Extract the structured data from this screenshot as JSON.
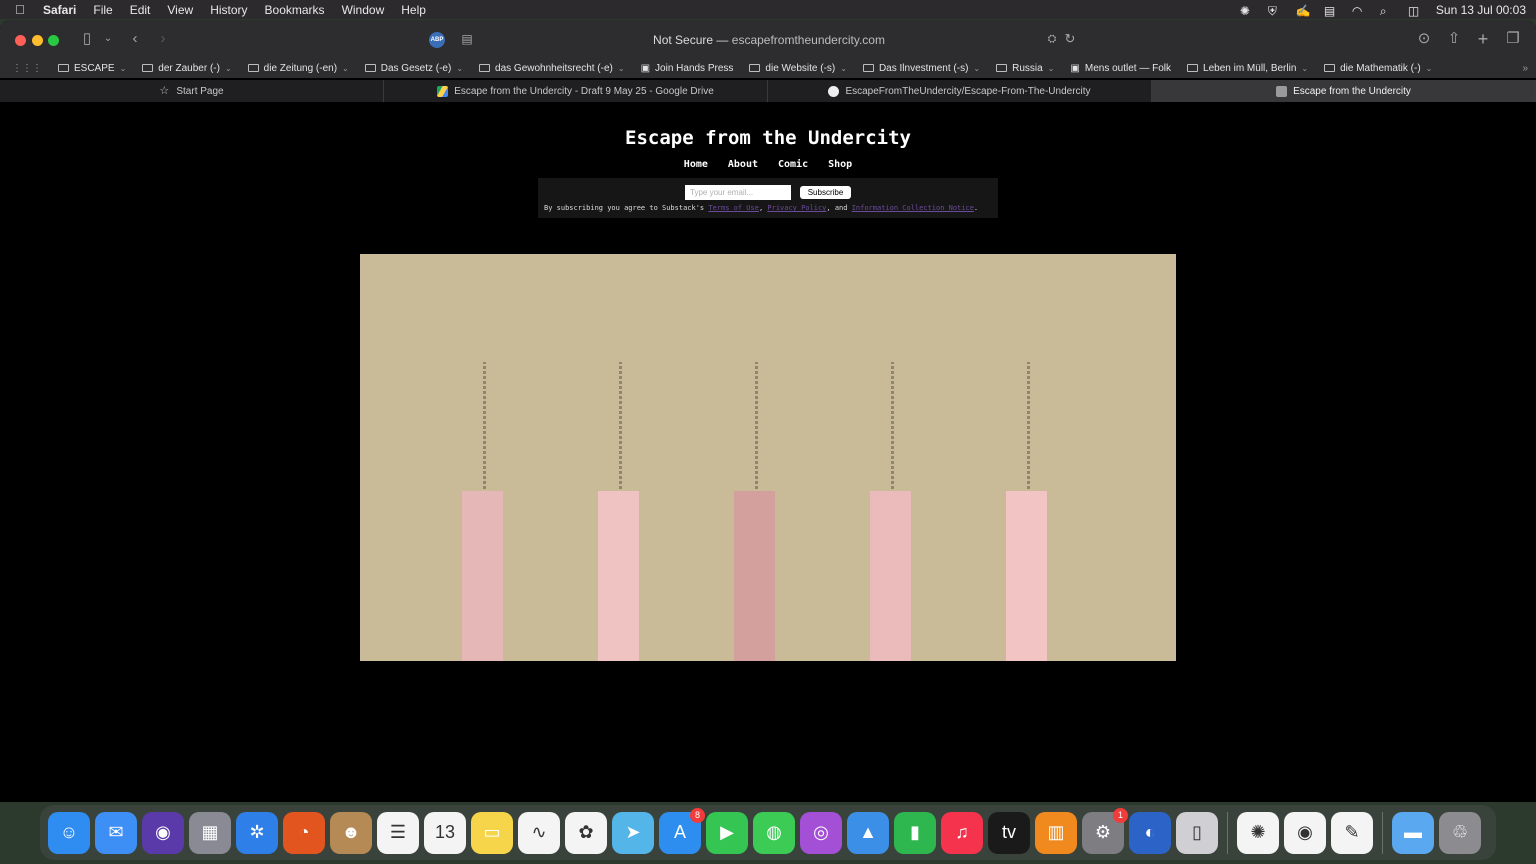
{
  "menubar": {
    "app_name": "Safari",
    "items": [
      "File",
      "Edit",
      "View",
      "History",
      "Bookmarks",
      "Window",
      "Help"
    ],
    "clock": "Sun 13 Jul  00:03"
  },
  "toolbar": {
    "address_prefix": "Not Secure —",
    "address_domain": "escapefromtheundercity.com",
    "adblock_label": "ABP"
  },
  "bookmarks": [
    {
      "label": "ESCAPE",
      "folder": true
    },
    {
      "label": "der Zauber (-)",
      "folder": true
    },
    {
      "label": "die Zeitung (-en)",
      "folder": true
    },
    {
      "label": "Das Gesetz (-e)",
      "folder": true
    },
    {
      "label": "das Gewohnheitsrecht (-e)",
      "folder": true
    },
    {
      "label": "Join Hands Press",
      "folder": false
    },
    {
      "label": "die Website (-s)",
      "folder": true
    },
    {
      "label": "Das Ilnvestment (-s)",
      "folder": true
    },
    {
      "label": "Russia",
      "folder": true
    },
    {
      "label": "Mens outlet — Folk",
      "folder": false
    },
    {
      "label": "Leben im Müll, Berlin",
      "folder": true
    },
    {
      "label": "die Mathematik (-)",
      "folder": true
    }
  ],
  "tabs": [
    {
      "label": "Start Page",
      "active": false
    },
    {
      "label": "Escape from the Undercity - Draft 9 May 25 - Google Drive",
      "active": false
    },
    {
      "label": "EscapeFromTheUndercity/Escape-From-The-Undercity",
      "active": false
    },
    {
      "label": "Escape from the Undercity",
      "active": true
    }
  ],
  "site": {
    "title": "Escape from the Undercity",
    "nav": [
      "Home",
      "About",
      "Comic",
      "Shop"
    ],
    "subscribe": {
      "placeholder": "Type your email...",
      "button": "Subscribe",
      "legal_prefix": "By subscribing you agree to Substack's",
      "terms": "Terms of Use",
      "privacy": "Privacy Policy",
      "and": ", and",
      "notice": "Information Collection Notice"
    }
  },
  "canvas": {
    "background": "#c9bb97",
    "blocks": [
      {
        "color": "#e5b7b7"
      },
      {
        "color": "#f0c3c3"
      },
      {
        "color": "#d4a09e"
      },
      {
        "color": "#ebbaba"
      },
      {
        "color": "#f2c4c4"
      }
    ]
  },
  "dock": {
    "apps": [
      {
        "name": "finder-icon",
        "color": "#2f8cf0",
        "glyph": "☺"
      },
      {
        "name": "mail-icon",
        "color": "#3d8ff5",
        "glyph": "✉"
      },
      {
        "name": "siri-icon",
        "color": "#5a3aa8",
        "glyph": "◉"
      },
      {
        "name": "launchpad-icon",
        "color": "#8a8a95",
        "glyph": "▦"
      },
      {
        "name": "safari-icon",
        "color": "#2f7fe8",
        "glyph": "✲"
      },
      {
        "name": "firefox-icon",
        "color": "#e2551f",
        "glyph": "◔"
      },
      {
        "name": "contacts-icon",
        "color": "#b58a55",
        "glyph": "☻"
      },
      {
        "name": "reminders-icon",
        "color": "#f4f4f4",
        "glyph": "☰"
      },
      {
        "name": "calendar-icon",
        "color": "#f4f4f4",
        "glyph": "13"
      },
      {
        "name": "notes-icon",
        "color": "#f6d54a",
        "glyph": "▭"
      },
      {
        "name": "freeform-icon",
        "color": "#f4f4f4",
        "glyph": "∿"
      },
      {
        "name": "photos-icon",
        "color": "#f4f4f4",
        "glyph": "✿"
      },
      {
        "name": "maps-icon",
        "color": "#53b5e8",
        "glyph": "➤"
      },
      {
        "name": "app-store-icon",
        "color": "#2d8ef0",
        "glyph": "A",
        "badge": "8"
      },
      {
        "name": "facetime-icon",
        "color": "#35c553",
        "glyph": "▶"
      },
      {
        "name": "messages-icon",
        "color": "#3ccb55",
        "glyph": "◍"
      },
      {
        "name": "podcasts-icon",
        "color": "#a34fd6",
        "glyph": "◎"
      },
      {
        "name": "keynote-icon",
        "color": "#3b8fe6",
        "glyph": "▲"
      },
      {
        "name": "numbers-icon",
        "color": "#2eb74e",
        "glyph": "▮"
      },
      {
        "name": "music-icon",
        "color": "#f5334c",
        "glyph": "♫"
      },
      {
        "name": "apple-tv-icon",
        "color": "#1a1a1a",
        "glyph": "tv"
      },
      {
        "name": "books-icon",
        "color": "#f08a1e",
        "glyph": "▥"
      },
      {
        "name": "system-settings-icon",
        "color": "#7d7d82",
        "glyph": "⚙",
        "badge": "1"
      },
      {
        "name": "ukraine-app-icon",
        "color": "#2b63c6",
        "glyph": "◐"
      },
      {
        "name": "iphone-mirroring-icon",
        "color": "#cfcfd4",
        "glyph": "▯"
      },
      {
        "sep": true
      },
      {
        "name": "chatgpt-icon",
        "color": "#f4f4f4",
        "glyph": "✺"
      },
      {
        "name": "chrome-icon",
        "color": "#f4f4f4",
        "glyph": "◉"
      },
      {
        "name": "textedit-icon",
        "color": "#f4f4f4",
        "glyph": "✎"
      },
      {
        "sep": true
      },
      {
        "name": "downloads-folder-icon",
        "color": "#5aa8f0",
        "glyph": "▬"
      },
      {
        "name": "trash-icon",
        "color": "#8c8c90",
        "glyph": "♲"
      }
    ]
  }
}
